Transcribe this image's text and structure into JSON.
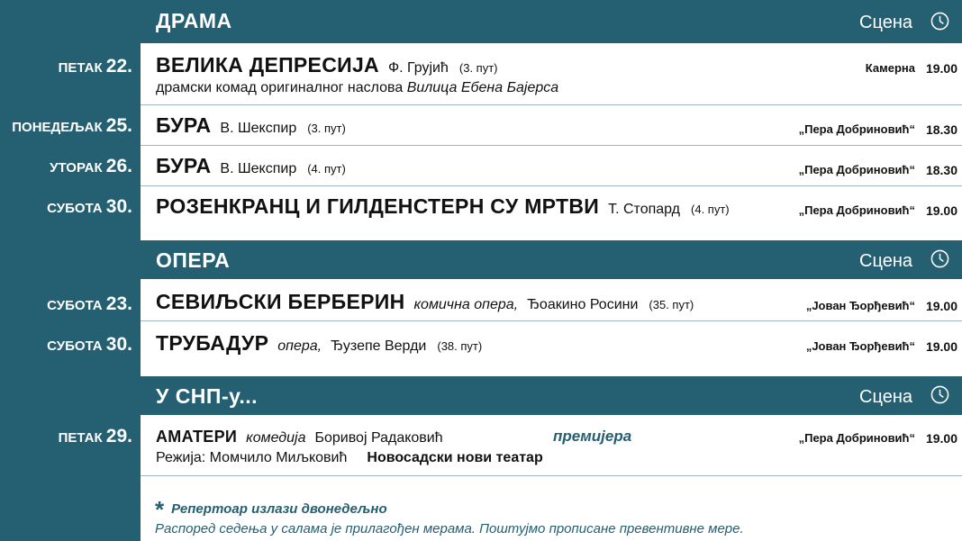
{
  "sections": [
    {
      "title": "ДРАМА",
      "scena": "Сцена",
      "shows": [
        {
          "day_name": "ПЕТАК",
          "day_num": "22.",
          "title": "ВЕЛИКА ДЕПРЕСИЈА",
          "author": "Ф. Грујић",
          "performance": "(3. пут)",
          "sub": "драмски комад оригиналног наслова",
          "sub_italic": "Вилица Ебена Бајерса",
          "venue": "Камерна",
          "time": "19.00"
        },
        {
          "day_name": "ПОНЕДЕЉАК",
          "day_num": "25.",
          "title": "БУРА",
          "author": "В. Шекспир",
          "performance": "(3. пут)",
          "venue": "„Пера Добриновић“",
          "time": "18.30"
        },
        {
          "day_name": "УТОРАК",
          "day_num": "26.",
          "title": "БУРА",
          "author": "В. Шекспир",
          "performance": "(4. пут)",
          "venue": "„Пера Добриновић“",
          "time": "18.30"
        },
        {
          "day_name": "СУБОТА",
          "day_num": "30.",
          "title": "РОЗЕНКРАНЦ И ГИЛДЕНСТЕРН СУ МРТВИ",
          "author": "Т. Стопард",
          "performance": "(4. пут)",
          "venue": "„Пера Добриновић“",
          "time": "19.00"
        }
      ]
    },
    {
      "title": "ОПЕРА",
      "scena": "Сцена",
      "shows": [
        {
          "day_name": "СУБОТА",
          "day_num": "23.",
          "title": "СЕВИЉСКИ БЕРБЕРИН",
          "genre": "комична опера,",
          "author": "Ђоакино Росини",
          "performance": "(35. пут)",
          "venue": "„Јован Ђорђевић“",
          "time": "19.00"
        },
        {
          "day_name": "СУБОТА",
          "day_num": "30.",
          "title": "ТРУБАДУР",
          "genre": "опера,",
          "author": "Ђузепе Верди",
          "performance": "(38. пут)",
          "venue": "„Јован Ђорђевић“",
          "time": "19.00"
        }
      ]
    },
    {
      "title": "У СНП-у...",
      "scena": "Сцена",
      "shows": [
        {
          "day_name": "ПЕТАК",
          "day_num": "29.",
          "title": "АМАТЕРИ",
          "genre": "комедија",
          "author": "Боривој Радаковић",
          "badge": "премијера",
          "director": "Режија: Момчило Миљковић",
          "company": "Новосадски нови театар",
          "venue": "„Пера Добриновић“",
          "time": "19.00"
        }
      ]
    }
  ],
  "footer": {
    "star": "*",
    "line1": "Репертоар излази двонедељно",
    "line2": "Распоред седења у салама је прилагођен мерама. Поштујмо прописане превентивне мере."
  },
  "colors": {
    "accent": "#245f72",
    "premiere": "#245f72"
  }
}
